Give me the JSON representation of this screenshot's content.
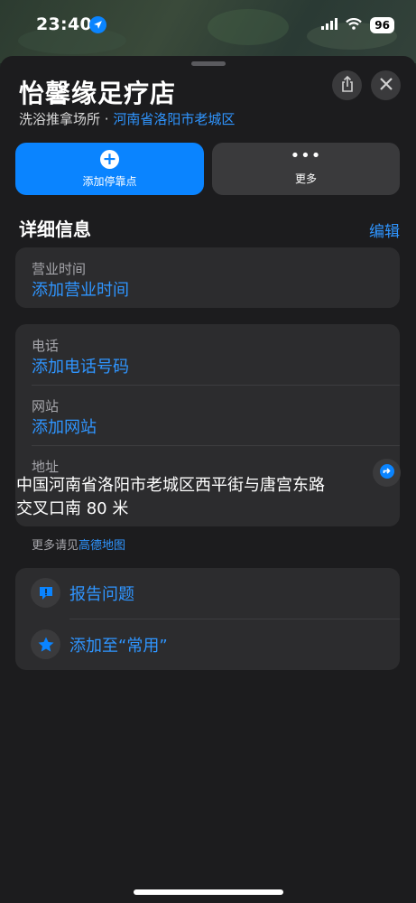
{
  "status_bar": {
    "time": "23:40",
    "battery": "96"
  },
  "place": {
    "name": "怡馨缘足疗店",
    "category": "洗浴推拿场所",
    "separator": "·",
    "region": "河南省洛阳市老城区"
  },
  "actions": {
    "primary_label": "添加停靠点",
    "secondary_label": "更多"
  },
  "details": {
    "heading": "详细信息",
    "edit_label": "编辑",
    "hours_label": "营业时间",
    "hours_action": "添加营业时间",
    "phone_label": "电话",
    "phone_action": "添加电话号码",
    "website_label": "网站",
    "website_action": "添加网站",
    "address_label": "地址",
    "address_value": "中国河南省洛阳市老城区西平街与唐宫东路交叉口南 80 米"
  },
  "more_info": {
    "prefix": "更多请见",
    "link": "高德地图"
  },
  "bottom_actions": {
    "report_label": "报告问题",
    "favorite_label": "添加至“常用”"
  },
  "colors": {
    "accent": "#0a84ff",
    "sheet_bg": "#1c1c1e",
    "card_bg": "#2c2c2e"
  }
}
